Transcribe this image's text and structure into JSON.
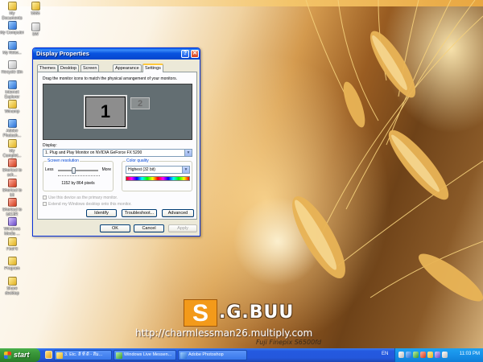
{
  "desktop": {
    "icons": [
      {
        "label": "My Documents",
        "icon": "folder-icon"
      },
      {
        "label": "My Computer",
        "icon": "computer-icon"
      },
      {
        "label": "My Netw...",
        "icon": "network-icon"
      },
      {
        "label": "Recycle Bin",
        "icon": "recycle-bin-icon"
      },
      {
        "label": "Internet Explorer",
        "icon": "ie-icon"
      },
      {
        "label": "Winamp",
        "icon": "winamp-icon"
      },
      {
        "label": "Adobe Photosh...",
        "icon": "photoshop-icon"
      },
      {
        "label": "My Complet...",
        "icon": "folder-icon"
      },
      {
        "label": "Shortcut to sch...",
        "icon": "shortcut-icon"
      },
      {
        "label": "Shortcut to bit",
        "icon": "shortcut-icon"
      },
      {
        "label": "Shortcut to bit13R",
        "icon": "shortcut-icon"
      },
      {
        "label": "Windows Media ...",
        "icon": "media-player-icon"
      },
      {
        "label": "FireFil",
        "icon": "folder-icon"
      },
      {
        "label": "Program",
        "icon": "folder-icon"
      },
      {
        "label": "Share desktop",
        "icon": "folder-icon"
      }
    ],
    "icons_col2": [
      {
        "label": "5555",
        "icon": "folder-icon"
      },
      {
        "label": "SW",
        "icon": "file-icon"
      }
    ],
    "watermark": {
      "logo_letter": "S",
      "logo_text": ".G.BUU",
      "url": "http://charmlessman26.multiply.com",
      "camera": "Fuji Finepix S6500fd"
    }
  },
  "dialog": {
    "title": "Display Properties",
    "help_button": "?",
    "close_button": "✕",
    "tabs": [
      "Themes",
      "Desktop",
      "Screen Saver",
      "Appearance",
      "Settings"
    ],
    "active_tab": "Settings",
    "instruction": "Drag the monitor icons to match the physical arrangement of your monitors.",
    "monitor_primary": "1",
    "monitor_secondary": "2",
    "display_label": "Display:",
    "display_value": "1. Plug and Play Monitor on NVIDIA GeForce FX 5200",
    "resolution": {
      "title": "Screen resolution",
      "less": "Less",
      "more": "More",
      "value": "1152 by 864 pixels"
    },
    "color_quality": {
      "title": "Color quality",
      "value": "Highest (32 bit)"
    },
    "primary_checkbox": "Use this device as the primary monitor.",
    "extend_checkbox": "Extend my Windows desktop onto this monitor.",
    "buttons": {
      "identify": "Identify",
      "troubleshoot": "Troubleshoot...",
      "advanced": "Advanced",
      "ok": "OK",
      "cancel": "Cancel",
      "apply": "Apply"
    }
  },
  "taskbar": {
    "start": "start",
    "tasks": [
      {
        "label": "3. Etc. สี ที่ ดี - สีม...",
        "icon": "folder-icon"
      },
      {
        "label": "Windows Live Messen...",
        "icon": "messenger-icon"
      },
      {
        "label": "Adobe Photoshop",
        "icon": "photoshop-icon"
      }
    ],
    "language": "EN",
    "clock": "11:03 PM"
  },
  "colors": {
    "titlebar": "#0a5fe8",
    "taskbar": "#2458dc",
    "start_button": "#3c9a3c",
    "tray": "#1790e8",
    "logo_orange": "#f39a1a"
  }
}
